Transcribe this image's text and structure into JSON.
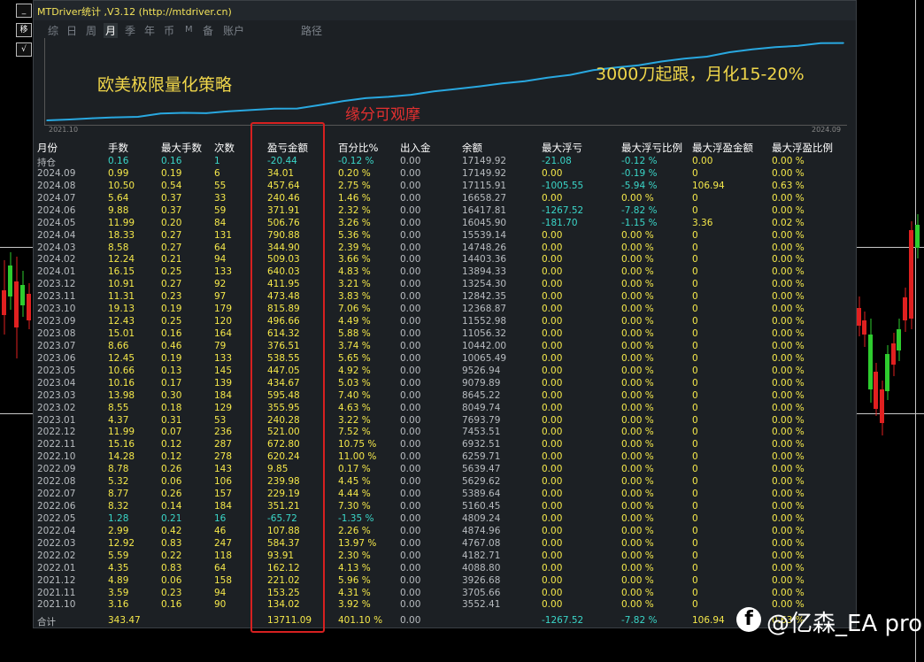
{
  "window": {
    "title": "MTDriver统计 ,V3.12 (http://mtdriver.cn)"
  },
  "side_buttons": [
    "_",
    "移",
    "√"
  ],
  "tabs": [
    {
      "label": "综",
      "active": false
    },
    {
      "label": "日",
      "active": false
    },
    {
      "label": "周",
      "active": false
    },
    {
      "label": "月",
      "active": true
    },
    {
      "label": "季",
      "active": false
    },
    {
      "label": "年",
      "active": false
    },
    {
      "label": "币",
      "active": false
    },
    {
      "label": "M",
      "active": false
    },
    {
      "label": "备",
      "active": false
    },
    {
      "label": "账户",
      "active": false
    },
    {
      "label": "路径",
      "active": false
    }
  ],
  "annotations": {
    "strategy": "欧美极限量化策略",
    "follow": "3000刀起跟，月化15-20%",
    "observe": "缘分可观摩"
  },
  "chart_data": {
    "type": "line",
    "x": [
      "2021.10",
      "2021.11",
      "2021.12",
      "2022.01",
      "2022.02",
      "2022.03",
      "2022.04",
      "2022.05",
      "2022.06",
      "2022.07",
      "2022.08",
      "2022.09",
      "2022.10",
      "2022.11",
      "2022.12",
      "2023.01",
      "2023.02",
      "2023.03",
      "2023.04",
      "2023.05",
      "2023.06",
      "2023.07",
      "2023.08",
      "2023.09",
      "2023.10",
      "2023.11",
      "2023.12",
      "2024.01",
      "2024.02",
      "2024.03",
      "2024.04",
      "2024.05",
      "2024.06",
      "2024.07",
      "2024.08",
      "2024.09"
    ],
    "series": [
      {
        "values": [
          3552.41,
          3705.66,
          3926.68,
          4088.8,
          4182.71,
          4767.08,
          4874.96,
          4809.24,
          5160.45,
          5389.64,
          5629.62,
          5639.47,
          6259.71,
          6932.51,
          7453.51,
          7693.79,
          8049.74,
          8645.22,
          9079.89,
          9526.94,
          10065.49,
          10442.0,
          11056.32,
          11552.98,
          12368.87,
          12842.35,
          13254.3,
          13894.33,
          14403.36,
          14748.26,
          15539.14,
          16045.9,
          16417.81,
          16658.27,
          17115.91,
          17149.92
        ]
      }
    ],
    "x_start_label": "2021.10",
    "x_end_label": "2024.09",
    "line_color": "#29a8e0"
  },
  "columns": [
    "月份",
    "手数",
    "最大手数",
    "次数",
    "盈亏金额",
    "百分比%",
    "出入金",
    "余额",
    "最大浮亏",
    "最大浮亏比例",
    "最大浮盈金额",
    "最大浮盈比例"
  ],
  "rows": [
    [
      "持仓",
      "0.16",
      "0.16",
      "1",
      "-20.44",
      "-0.12 %",
      "0.00",
      "17149.92",
      "-21.08",
      "-0.12 %",
      "0.00",
      "0.00 %"
    ],
    [
      "2024.09",
      "0.99",
      "0.19",
      "6",
      "34.01",
      "0.20 %",
      "0.00",
      "17149.92",
      "0.00",
      "-0.19 %",
      "0",
      "0.00 %"
    ],
    [
      "2024.08",
      "10.50",
      "0.54",
      "55",
      "457.64",
      "2.75 %",
      "0.00",
      "17115.91",
      "-1005.55",
      "-5.94 %",
      "106.94",
      "0.63 %"
    ],
    [
      "2024.07",
      "5.64",
      "0.37",
      "33",
      "240.46",
      "1.46 %",
      "0.00",
      "16658.27",
      "0.00",
      "0.00 %",
      "0",
      "0.00 %"
    ],
    [
      "2024.06",
      "9.88",
      "0.37",
      "59",
      "371.91",
      "2.32 %",
      "0.00",
      "16417.81",
      "-1267.52",
      "-7.82 %",
      "0",
      "0.00 %"
    ],
    [
      "2024.05",
      "11.99",
      "0.20",
      "84",
      "506.76",
      "3.26 %",
      "0.00",
      "16045.90",
      "-181.70",
      "-1.15 %",
      "3.36",
      "0.02 %"
    ],
    [
      "2024.04",
      "18.33",
      "0.27",
      "131",
      "790.88",
      "5.36 %",
      "0.00",
      "15539.14",
      "0.00",
      "0.00 %",
      "0",
      "0.00 %"
    ],
    [
      "2024.03",
      "8.58",
      "0.27",
      "64",
      "344.90",
      "2.39 %",
      "0.00",
      "14748.26",
      "0.00",
      "0.00 %",
      "0",
      "0.00 %"
    ],
    [
      "2024.02",
      "12.24",
      "0.21",
      "94",
      "509.03",
      "3.66 %",
      "0.00",
      "14403.36",
      "0.00",
      "0.00 %",
      "0",
      "0.00 %"
    ],
    [
      "2024.01",
      "16.15",
      "0.25",
      "133",
      "640.03",
      "4.83 %",
      "0.00",
      "13894.33",
      "0.00",
      "0.00 %",
      "0",
      "0.00 %"
    ],
    [
      "2023.12",
      "10.91",
      "0.27",
      "92",
      "411.95",
      "3.21 %",
      "0.00",
      "13254.30",
      "0.00",
      "0.00 %",
      "0",
      "0.00 %"
    ],
    [
      "2023.11",
      "11.31",
      "0.23",
      "97",
      "473.48",
      "3.83 %",
      "0.00",
      "12842.35",
      "0.00",
      "0.00 %",
      "0",
      "0.00 %"
    ],
    [
      "2023.10",
      "19.13",
      "0.19",
      "179",
      "815.89",
      "7.06 %",
      "0.00",
      "12368.87",
      "0.00",
      "0.00 %",
      "0",
      "0.00 %"
    ],
    [
      "2023.09",
      "12.43",
      "0.25",
      "120",
      "496.66",
      "4.49 %",
      "0.00",
      "11552.98",
      "0.00",
      "0.00 %",
      "0",
      "0.00 %"
    ],
    [
      "2023.08",
      "15.01",
      "0.16",
      "164",
      "614.32",
      "5.88 %",
      "0.00",
      "11056.32",
      "0.00",
      "0.00 %",
      "0",
      "0.00 %"
    ],
    [
      "2023.07",
      "8.66",
      "0.46",
      "79",
      "376.51",
      "3.74 %",
      "0.00",
      "10442.00",
      "0.00",
      "0.00 %",
      "0",
      "0.00 %"
    ],
    [
      "2023.06",
      "12.45",
      "0.19",
      "133",
      "538.55",
      "5.65 %",
      "0.00",
      "10065.49",
      "0.00",
      "0.00 %",
      "0",
      "0.00 %"
    ],
    [
      "2023.05",
      "10.66",
      "0.13",
      "145",
      "447.05",
      "4.92 %",
      "0.00",
      "9526.94",
      "0.00",
      "0.00 %",
      "0",
      "0.00 %"
    ],
    [
      "2023.04",
      "10.16",
      "0.17",
      "139",
      "434.67",
      "5.03 %",
      "0.00",
      "9079.89",
      "0.00",
      "0.00 %",
      "0",
      "0.00 %"
    ],
    [
      "2023.03",
      "13.98",
      "0.30",
      "184",
      "595.48",
      "7.40 %",
      "0.00",
      "8645.22",
      "0.00",
      "0.00 %",
      "0",
      "0.00 %"
    ],
    [
      "2023.02",
      "8.55",
      "0.18",
      "129",
      "355.95",
      "4.63 %",
      "0.00",
      "8049.74",
      "0.00",
      "0.00 %",
      "0",
      "0.00 %"
    ],
    [
      "2023.01",
      "4.37",
      "0.31",
      "53",
      "240.28",
      "3.22 %",
      "0.00",
      "7693.79",
      "0.00",
      "0.00 %",
      "0",
      "0.00 %"
    ],
    [
      "2022.12",
      "11.99",
      "0.07",
      "236",
      "521.00",
      "7.52 %",
      "0.00",
      "7453.51",
      "0.00",
      "0.00 %",
      "0",
      "0.00 %"
    ],
    [
      "2022.11",
      "15.16",
      "0.12",
      "287",
      "672.80",
      "10.75 %",
      "0.00",
      "6932.51",
      "0.00",
      "0.00 %",
      "0",
      "0.00 %"
    ],
    [
      "2022.10",
      "14.28",
      "0.12",
      "278",
      "620.24",
      "11.00 %",
      "0.00",
      "6259.71",
      "0.00",
      "0.00 %",
      "0",
      "0.00 %"
    ],
    [
      "2022.09",
      "8.78",
      "0.26",
      "143",
      "9.85",
      "0.17 %",
      "0.00",
      "5639.47",
      "0.00",
      "0.00 %",
      "0",
      "0.00 %"
    ],
    [
      "2022.08",
      "5.32",
      "0.06",
      "106",
      "239.98",
      "4.45 %",
      "0.00",
      "5629.62",
      "0.00",
      "0.00 %",
      "0",
      "0.00 %"
    ],
    [
      "2022.07",
      "8.77",
      "0.26",
      "157",
      "229.19",
      "4.44 %",
      "0.00",
      "5389.64",
      "0.00",
      "0.00 %",
      "0",
      "0.00 %"
    ],
    [
      "2022.06",
      "8.32",
      "0.14",
      "184",
      "351.21",
      "7.30 %",
      "0.00",
      "5160.45",
      "0.00",
      "0.00 %",
      "0",
      "0.00 %"
    ],
    [
      "2022.05",
      "1.28",
      "0.21",
      "16",
      "-65.72",
      "-1.35 %",
      "0.00",
      "4809.24",
      "0.00",
      "0.00 %",
      "0",
      "0.00 %"
    ],
    [
      "2022.04",
      "2.99",
      "0.42",
      "46",
      "107.88",
      "2.26 %",
      "0.00",
      "4874.96",
      "0.00",
      "0.00 %",
      "0",
      "0.00 %"
    ],
    [
      "2022.03",
      "12.92",
      "0.83",
      "247",
      "584.37",
      "13.97 %",
      "0.00",
      "4767.08",
      "0.00",
      "0.00 %",
      "0",
      "0.00 %"
    ],
    [
      "2022.02",
      "5.59",
      "0.22",
      "118",
      "93.91",
      "2.30 %",
      "0.00",
      "4182.71",
      "0.00",
      "0.00 %",
      "0",
      "0.00 %"
    ],
    [
      "2022.01",
      "4.35",
      "0.83",
      "64",
      "162.12",
      "4.13 %",
      "0.00",
      "4088.80",
      "0.00",
      "0.00 %",
      "0",
      "0.00 %"
    ],
    [
      "2021.12",
      "4.89",
      "0.06",
      "158",
      "221.02",
      "5.96 %",
      "0.00",
      "3926.68",
      "0.00",
      "0.00 %",
      "0",
      "0.00 %"
    ],
    [
      "2021.11",
      "3.59",
      "0.23",
      "94",
      "153.25",
      "4.31 %",
      "0.00",
      "3705.66",
      "0.00",
      "0.00 %",
      "0",
      "0.00 %"
    ],
    [
      "2021.10",
      "3.16",
      "0.16",
      "90",
      "134.02",
      "3.92 %",
      "0.00",
      "3552.41",
      "0.00",
      "0.00 %",
      "0",
      "0.00 %"
    ]
  ],
  "total": [
    "合计",
    "343.47",
    "",
    "",
    "13711.09",
    "401.10 %",
    "0.00",
    "",
    "-1267.52",
    "-7.82 %",
    "106.94",
    "0.63 %"
  ],
  "watermark": "@亿森_EA pro",
  "watermark_logo": "f",
  "colors": {
    "positive": "#f5e84a",
    "negative": "#3ad6c8",
    "highlight_box": "#d62020",
    "candle_up": "#2ecc2e",
    "candle_down": "#e02020"
  }
}
